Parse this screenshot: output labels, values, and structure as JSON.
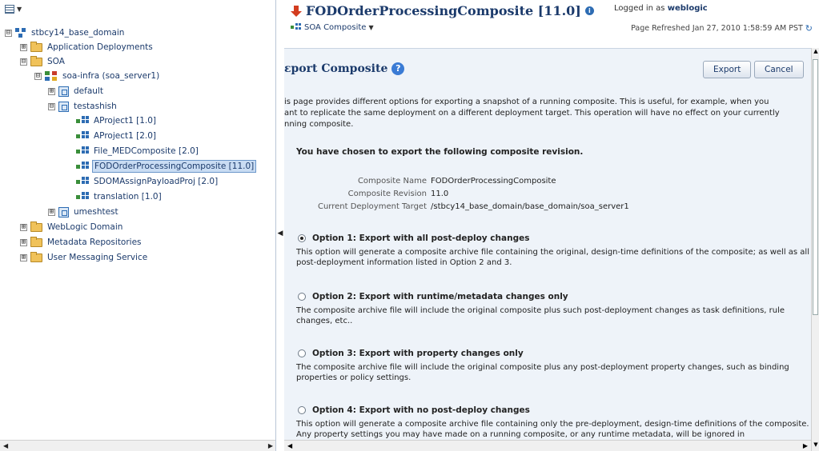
{
  "nav_tree": {
    "items": [
      {
        "label": "stbcy14_base_domain",
        "toggle": "⊟",
        "icon": "domain-icon"
      },
      {
        "label": "Application Deployments",
        "toggle": "⊞",
        "icon": "folder-icon"
      },
      {
        "label": "SOA",
        "toggle": "⊟",
        "icon": "folder-icon"
      },
      {
        "label": "soa-infra (soa_server1)",
        "toggle": "⊟",
        "icon": "soa-infra-icon"
      },
      {
        "label": "default",
        "toggle": "⊞",
        "icon": "partition-icon"
      },
      {
        "label": "testashish",
        "toggle": "⊟",
        "icon": "partition-icon"
      },
      {
        "label": "AProject1 [1.0]",
        "toggle": "",
        "icon": "composite-icon"
      },
      {
        "label": "AProject1 [2.0]",
        "toggle": "",
        "icon": "composite-icon"
      },
      {
        "label": "File_MEDComposite [2.0]",
        "toggle": "",
        "icon": "composite-icon"
      },
      {
        "label": "FODOrderProcessingComposite [11.0]",
        "toggle": "",
        "icon": "composite-icon",
        "selected": true
      },
      {
        "label": "SDOMAssignPayloadProj [2.0]",
        "toggle": "",
        "icon": "composite-icon"
      },
      {
        "label": "translation [1.0]",
        "toggle": "",
        "icon": "composite-icon"
      },
      {
        "label": "umeshtest",
        "toggle": "⊞",
        "icon": "partition-icon"
      },
      {
        "label": "WebLogic Domain",
        "toggle": "⊞",
        "icon": "folder-icon"
      },
      {
        "label": "Metadata Repositories",
        "toggle": "⊞",
        "icon": "folder-icon"
      },
      {
        "label": "User Messaging Service",
        "toggle": "⊞",
        "icon": "folder-icon"
      }
    ]
  },
  "header": {
    "title": "FODOrderProcessingComposite [11.0]",
    "subtitle_menu": "SOA Composite",
    "logged_in_prefix": "Logged in as",
    "logged_in_user": "weblogic",
    "page_refreshed": "Page Refreshed Jan 27, 2010 1:58:59 AM PST"
  },
  "content": {
    "title": "ɛport Composite",
    "export_label": "Export",
    "cancel_label": "Cancel",
    "intro_lines": [
      "is page provides different options for exporting a snapshot of a running composite. This is useful, for example, when you",
      "ant to replicate the same deployment on a different deployment target. This operation will have no effect on your currently",
      "nning composite."
    ],
    "chosen_heading": "You have chosen to export the following composite revision.",
    "details": [
      {
        "key": "Composite Name",
        "value": "FODOrderProcessingComposite"
      },
      {
        "key": "Composite Revision",
        "value": "11.0"
      },
      {
        "key": "Current Deployment Target",
        "value": "/stbcy14_base_domain/base_domain/soa_server1"
      }
    ],
    "options": [
      {
        "label": "Option 1: Export with all post-deploy changes",
        "checked": true,
        "desc": "This option will generate a composite archive file containing the original, design-time definitions of the composite; as well as all post-deployment information listed in Option 2 and 3."
      },
      {
        "label": "Option 2: Export with runtime/metadata changes only",
        "checked": false,
        "desc": "The composite archive file will include the original composite plus such post-deployment changes as task definitions, rule changes, etc.."
      },
      {
        "label": "Option 3: Export with property changes only",
        "checked": false,
        "desc": "The composite archive file will include the original composite plus any post-deployment property changes, such as binding properties or policy settings."
      },
      {
        "label": "Option 4: Export with no post-deploy changes",
        "checked": false,
        "desc": "This option will generate a composite archive file containing only the pre-deployment, design-time definitions of the composite. Any property settings you may have made on a running composite, or any runtime metadata, will be ignored in"
      }
    ]
  },
  "colors": {
    "title_blue": "#1b3a6b",
    "content_bg": "#eef3f9",
    "selection_bg": "#c9dcf3",
    "arrow_red": "#d33c1f"
  }
}
